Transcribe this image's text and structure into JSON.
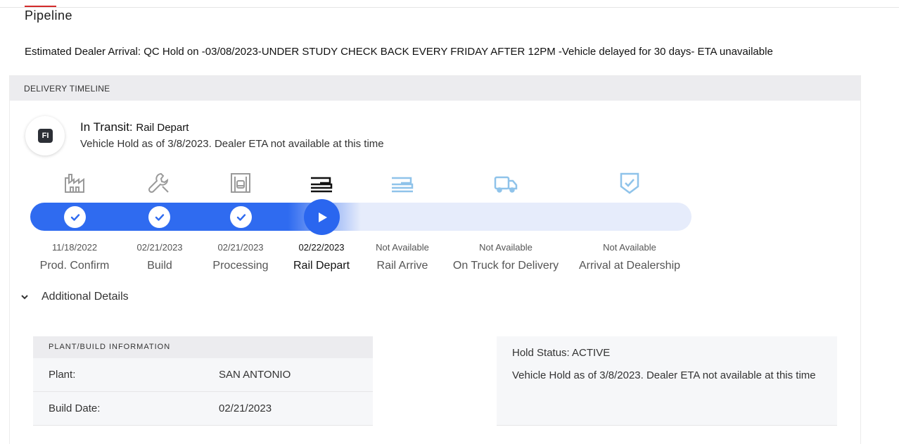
{
  "page": {
    "title": "Pipeline",
    "estimated_arrival": "Estimated Dealer Arrival: QC Hold on -03/08/2023-UNDER STUDY CHECK BACK EVERY FRIDAY AFTER 12PM -Vehicle delayed for 30 days- ETA unavailable"
  },
  "timeline": {
    "header": "DELIVERY TIMELINE",
    "badge": "FI",
    "status_label": "In Transit:",
    "status_value": "Rail Depart",
    "status_desc": "Vehicle Hold as of 3/8/2023. Dealer ETA not available at this time",
    "progress_stage": "Rail Depart",
    "stages": [
      {
        "name": "Prod. Confirm",
        "date": "11/18/2022",
        "icon": "factory-icon",
        "state": "complete"
      },
      {
        "name": "Build",
        "date": "02/21/2023",
        "icon": "wrench-icon",
        "state": "complete"
      },
      {
        "name": "Processing",
        "date": "02/21/2023",
        "icon": "processing-bay-icon",
        "state": "complete"
      },
      {
        "name": "Rail Depart",
        "date": "02/22/2023",
        "icon": "rail-car-icon",
        "state": "current"
      },
      {
        "name": "Rail Arrive",
        "date": "Not Available",
        "icon": "rail-car-icon",
        "state": "pending"
      },
      {
        "name": "On Truck for Delivery",
        "date": "Not Available",
        "icon": "truck-icon",
        "state": "pending"
      },
      {
        "name": "Arrival at Dealership",
        "date": "Not Available",
        "icon": "shield-check-icon",
        "state": "pending"
      }
    ],
    "colors": {
      "progress": "#2f6bf0",
      "track": "#e6ecfb",
      "pending_icon": "#8fc3ea",
      "done_icon": "#9a9a9a"
    }
  },
  "details": {
    "toggle_label": "Additional Details",
    "plant_header": "PLANT/BUILD INFORMATION",
    "plant_label": "Plant:",
    "plant_value": "SAN ANTONIO",
    "build_date_label": "Build Date:",
    "build_date_value": "02/21/2023",
    "hold_status": "Hold Status: ACTIVE",
    "hold_desc": "Vehicle Hold as of 3/8/2023. Dealer ETA not available at this time"
  }
}
